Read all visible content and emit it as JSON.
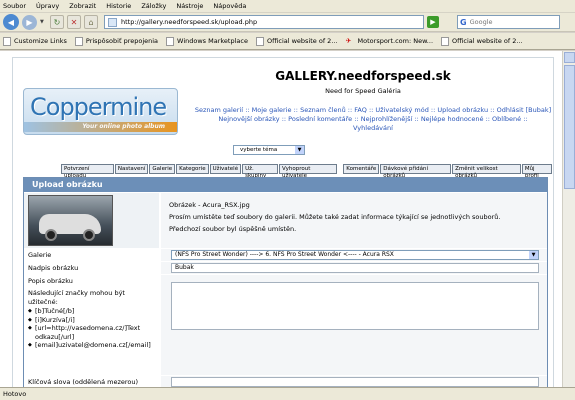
{
  "browser": {
    "menu": [
      "Soubor",
      "Úpravy",
      "Zobrazit",
      "Historie",
      "Záložky",
      "Nástroje",
      "Nápověda"
    ],
    "url": "http://gallery.needforspeed.sk/upload.php",
    "search_placeholder": "Google",
    "bookmarks": [
      "Customize Links",
      "Prispôsobiť prepojenia",
      "Windows Marketplace",
      "Official website of 2...",
      "Motorsport.com: New...",
      "Official website of 2..."
    ],
    "status": "Hotovo"
  },
  "site": {
    "logo_text": "Coppermine",
    "logo_tagline": "Your online photo album",
    "title": "GALLERY.needforspeed.sk",
    "description": "Need for Speed Galéria",
    "nav": [
      "Seznam galerií",
      "Moje galerie",
      "Seznam členů",
      "FAQ",
      "Uživatelský mód",
      "Upload obrázku",
      "Odhlásit [Bubak]",
      "Nejnovější obrázky",
      "Poslední komentáře",
      "Nejprohlíženější",
      "Nejlépe hodnocené",
      "Oblíbené",
      "Vyhledávání"
    ],
    "theme_select": "vyberte téma",
    "admin": [
      "Potvrzení uploadu",
      "Nastavení",
      "Galerie",
      "Kategorie",
      "Uživatelé",
      "Už. skupiny",
      "Vyhoprout uživatele",
      "Komentáře",
      "Dávkové přidání obrázků",
      "Změnit velikost obrázků",
      "Můj profil"
    ]
  },
  "upload": {
    "header": "Upload obrázku",
    "filename": "Obrázek - Acura_RSX.jpg",
    "prompt": "Prosím umístěte teď soubory do galerii. Můžete také zadat informace týkající se jednotlivých souborů.",
    "prev_status": "Předchozí soubor byl úspěšně umístěn.",
    "gallery_label": "Galerie",
    "gallery_value": "(NFS Pro Street Wonder) ----> 6. NFS Pro Street Wonder <---- - Acura RSX",
    "title_label": "Nadpis obrázku",
    "title_value": "Bubak",
    "desc_label": "Popis obrázku",
    "notes_intro": "Následující značky mohou být užitečné:",
    "notes": [
      "[b]Tučné[/b]",
      "[i]Kurzíva[/i]",
      "[url=http://vasedomena.cz/]Text odkazu[/url]",
      "[email]uzivatel@domena.cz[/email]"
    ],
    "keywords_label": "Klíčová slova (oddělená mezerou)"
  }
}
